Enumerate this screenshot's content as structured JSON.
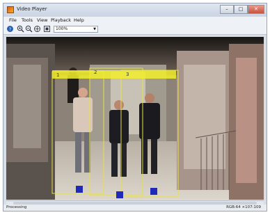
{
  "window": {
    "title": "Video Player"
  },
  "window_controls": {
    "minimize": "–",
    "maximize": "□",
    "close": "✕"
  },
  "menu": [
    "File",
    "Tools",
    "View",
    "Playback",
    "Help"
  ],
  "toolbar": {
    "icons": [
      "help-icon",
      "zoom-in-icon",
      "zoom-out-icon",
      "pan-icon",
      "fit-icon"
    ],
    "zoom_value": "100%"
  },
  "video": {
    "tracks": [
      {
        "id": "1"
      },
      {
        "id": "2"
      },
      {
        "id": "3"
      }
    ],
    "colors": {
      "box": "#e8e23a",
      "label_band": "#f2ee2a",
      "marker": "#1f2ab8"
    }
  },
  "status": {
    "left": "Processing",
    "right": "RGB:64 ×107:109"
  }
}
